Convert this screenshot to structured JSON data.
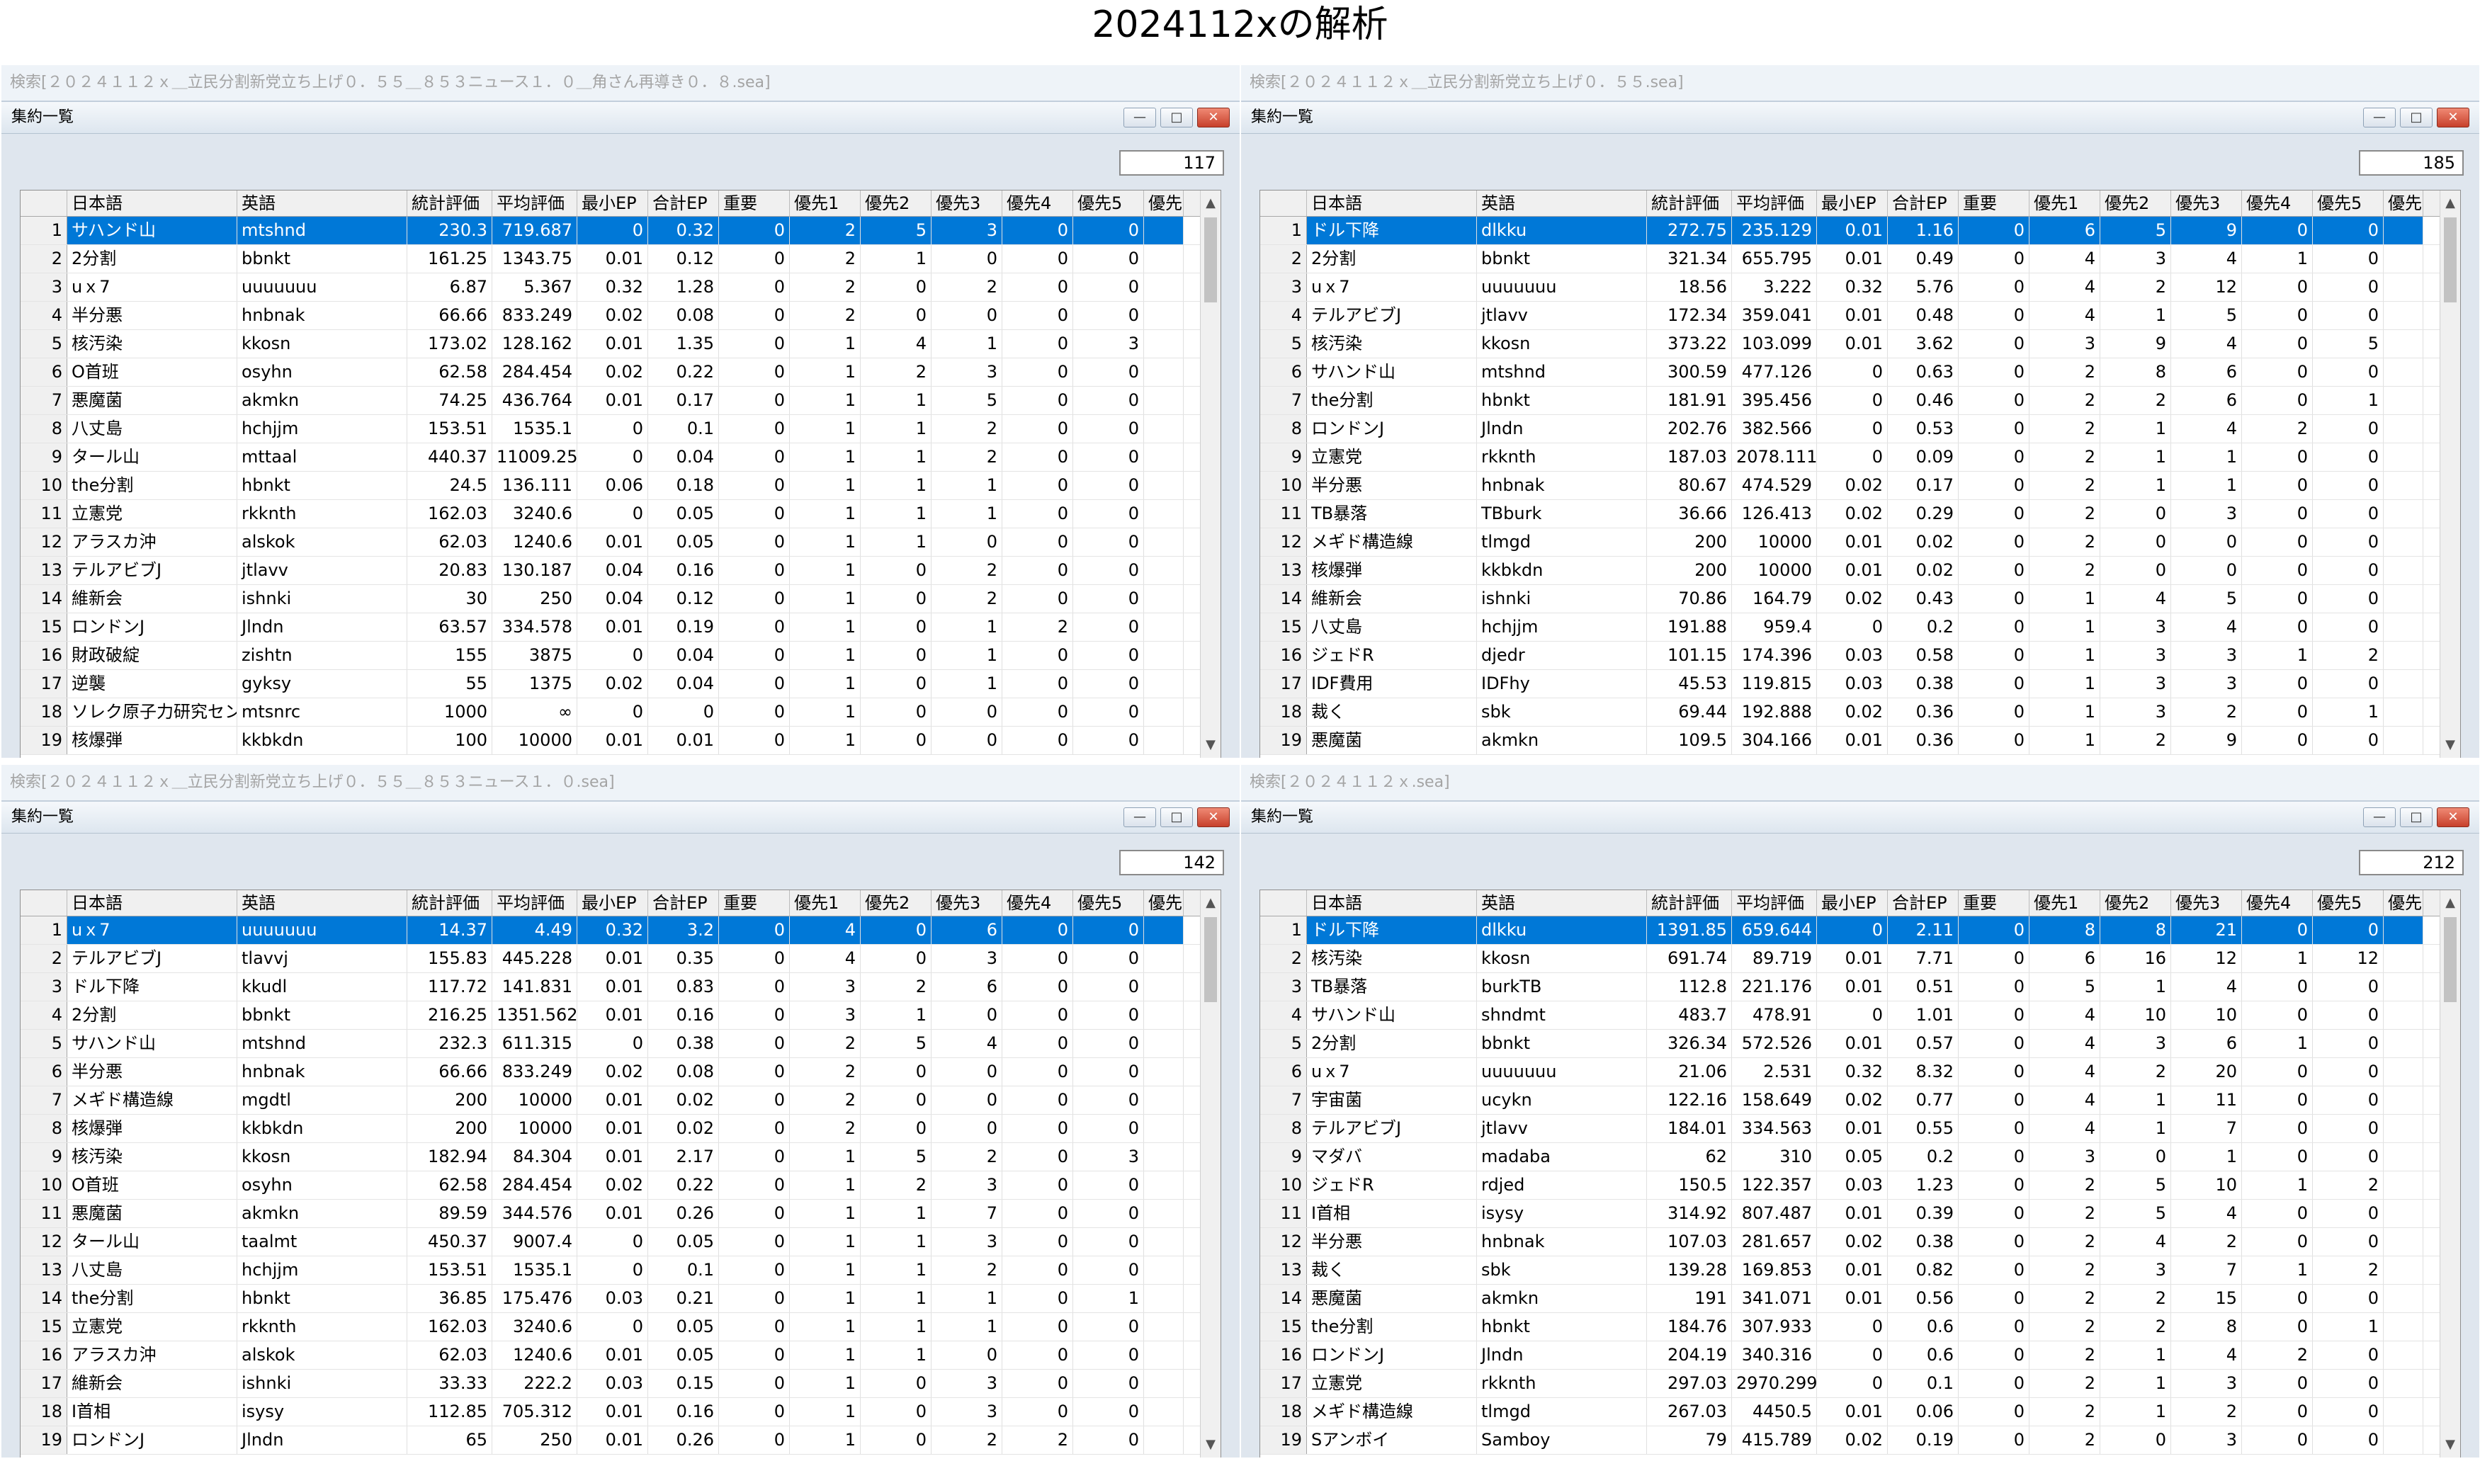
{
  "page_title": "2024112xの解析",
  "columns": [
    "日本語",
    "英語",
    "統計評価",
    "平均評価",
    "最小EP",
    "合計EP",
    "重要",
    "優先1",
    "優先2",
    "優先3",
    "優先4",
    "優先5",
    "優先"
  ],
  "window_title": "集約一覧",
  "panels": [
    {
      "search": "検索[２０２４１１２ｘ＿立民分割新党立ち上げ０．５５＿８５３ニュース１．０＿角さん再導き０．８.sea]",
      "count": "117",
      "selected_row": 0,
      "rows": [
        [
          "1",
          "サハンド山",
          "mtshnd",
          "230.3",
          "719.687",
          "0",
          "0.32",
          "0",
          "2",
          "5",
          "3",
          "0",
          "0"
        ],
        [
          "2",
          "2分割",
          "bbnkt",
          "161.25",
          "1343.75",
          "0.01",
          "0.12",
          "0",
          "2",
          "1",
          "0",
          "0",
          "0"
        ],
        [
          "3",
          "uｘ7",
          "uuuuuuu",
          "6.87",
          "5.367",
          "0.32",
          "1.28",
          "0",
          "2",
          "0",
          "2",
          "0",
          "0"
        ],
        [
          "4",
          "半分悪",
          "hnbnak",
          "66.66",
          "833.249",
          "0.02",
          "0.08",
          "0",
          "2",
          "0",
          "0",
          "0",
          "0"
        ],
        [
          "5",
          "核汚染",
          "kkosn",
          "173.02",
          "128.162",
          "0.01",
          "1.35",
          "0",
          "1",
          "4",
          "1",
          "0",
          "3"
        ],
        [
          "6",
          "O首班",
          "osyhn",
          "62.58",
          "284.454",
          "0.02",
          "0.22",
          "0",
          "1",
          "2",
          "3",
          "0",
          "0"
        ],
        [
          "7",
          "悪魔菌",
          "akmkn",
          "74.25",
          "436.764",
          "0.01",
          "0.17",
          "0",
          "1",
          "1",
          "5",
          "0",
          "0"
        ],
        [
          "8",
          "八丈島",
          "hchjjm",
          "153.51",
          "1535.1",
          "0",
          "0.1",
          "0",
          "1",
          "1",
          "2",
          "0",
          "0"
        ],
        [
          "9",
          "タール山",
          "mttaal",
          "440.37",
          "11009.25",
          "0",
          "0.04",
          "0",
          "1",
          "1",
          "2",
          "0",
          "0"
        ],
        [
          "10",
          "the分割",
          "hbnkt",
          "24.5",
          "136.111",
          "0.06",
          "0.18",
          "0",
          "1",
          "1",
          "1",
          "0",
          "0"
        ],
        [
          "11",
          "立憲党",
          "rkknth",
          "162.03",
          "3240.6",
          "0",
          "0.05",
          "0",
          "1",
          "1",
          "1",
          "0",
          "0"
        ],
        [
          "12",
          "アラスカ沖",
          "alskok",
          "62.03",
          "1240.6",
          "0.01",
          "0.05",
          "0",
          "1",
          "1",
          "0",
          "0",
          "0"
        ],
        [
          "13",
          "テルアビブJ",
          "jtlavv",
          "20.83",
          "130.187",
          "0.04",
          "0.16",
          "0",
          "1",
          "0",
          "2",
          "0",
          "0"
        ],
        [
          "14",
          "維新会",
          "ishnki",
          "30",
          "250",
          "0.04",
          "0.12",
          "0",
          "1",
          "0",
          "2",
          "0",
          "0"
        ],
        [
          "15",
          "ロンドンJ",
          "Jlndn",
          "63.57",
          "334.578",
          "0.01",
          "0.19",
          "0",
          "1",
          "0",
          "1",
          "2",
          "0"
        ],
        [
          "16",
          "財政破綻",
          "zishtn",
          "155",
          "3875",
          "0",
          "0.04",
          "0",
          "1",
          "0",
          "1",
          "0",
          "0"
        ],
        [
          "17",
          "逆襲",
          "gyksy",
          "55",
          "1375",
          "0.02",
          "0.04",
          "0",
          "1",
          "0",
          "1",
          "0",
          "0"
        ],
        [
          "18",
          "ソレク原子力研究セン",
          "mtsnrc",
          "1000",
          "∞",
          "0",
          "0",
          "0",
          "1",
          "0",
          "0",
          "0",
          "0"
        ],
        [
          "19",
          "核爆弾",
          "kkbkdn",
          "100",
          "10000",
          "0.01",
          "0.01",
          "0",
          "1",
          "0",
          "0",
          "0",
          "0"
        ]
      ]
    },
    {
      "search": "検索[２０２４１１２ｘ＿立民分割新党立ち上げ０．５５.sea]",
      "count": "185",
      "selected_row": 0,
      "rows": [
        [
          "1",
          "ドル下降",
          "dlkku",
          "272.75",
          "235.129",
          "0.01",
          "1.16",
          "0",
          "6",
          "5",
          "9",
          "0",
          "0"
        ],
        [
          "2",
          "2分割",
          "bbnkt",
          "321.34",
          "655.795",
          "0.01",
          "0.49",
          "0",
          "4",
          "3",
          "4",
          "1",
          "0"
        ],
        [
          "3",
          "uｘ7",
          "uuuuuuu",
          "18.56",
          "3.222",
          "0.32",
          "5.76",
          "0",
          "4",
          "2",
          "12",
          "0",
          "0"
        ],
        [
          "4",
          "テルアビブJ",
          "jtlavv",
          "172.34",
          "359.041",
          "0.01",
          "0.48",
          "0",
          "4",
          "1",
          "5",
          "0",
          "0"
        ],
        [
          "5",
          "核汚染",
          "kkosn",
          "373.22",
          "103.099",
          "0.01",
          "3.62",
          "0",
          "3",
          "9",
          "4",
          "0",
          "5"
        ],
        [
          "6",
          "サハンド山",
          "mtshnd",
          "300.59",
          "477.126",
          "0",
          "0.63",
          "0",
          "2",
          "8",
          "6",
          "0",
          "0"
        ],
        [
          "7",
          "the分割",
          "hbnkt",
          "181.91",
          "395.456",
          "0",
          "0.46",
          "0",
          "2",
          "2",
          "6",
          "0",
          "1"
        ],
        [
          "8",
          "ロンドンJ",
          "Jlndn",
          "202.76",
          "382.566",
          "0",
          "0.53",
          "0",
          "2",
          "1",
          "4",
          "2",
          "0"
        ],
        [
          "9",
          "立憲党",
          "rkknth",
          "187.03",
          "2078.111",
          "0",
          "0.09",
          "0",
          "2",
          "1",
          "1",
          "0",
          "0"
        ],
        [
          "10",
          "半分悪",
          "hnbnak",
          "80.67",
          "474.529",
          "0.02",
          "0.17",
          "0",
          "2",
          "1",
          "1",
          "0",
          "0"
        ],
        [
          "11",
          "TB暴落",
          "TBburk",
          "36.66",
          "126.413",
          "0.02",
          "0.29",
          "0",
          "2",
          "0",
          "3",
          "0",
          "0"
        ],
        [
          "12",
          "メギド構造線",
          "tlmgd",
          "200",
          "10000",
          "0.01",
          "0.02",
          "0",
          "2",
          "0",
          "0",
          "0",
          "0"
        ],
        [
          "13",
          "核爆弾",
          "kkbkdn",
          "200",
          "10000",
          "0.01",
          "0.02",
          "0",
          "2",
          "0",
          "0",
          "0",
          "0"
        ],
        [
          "14",
          "維新会",
          "ishnki",
          "70.86",
          "164.79",
          "0.02",
          "0.43",
          "0",
          "1",
          "4",
          "5",
          "0",
          "0"
        ],
        [
          "15",
          "八丈島",
          "hchjjm",
          "191.88",
          "959.4",
          "0",
          "0.2",
          "0",
          "1",
          "3",
          "4",
          "0",
          "0"
        ],
        [
          "16",
          "ジェドR",
          "djedr",
          "101.15",
          "174.396",
          "0.03",
          "0.58",
          "0",
          "1",
          "3",
          "3",
          "1",
          "2"
        ],
        [
          "17",
          "IDF費用",
          "IDFhy",
          "45.53",
          "119.815",
          "0.03",
          "0.38",
          "0",
          "1",
          "3",
          "3",
          "0",
          "0"
        ],
        [
          "18",
          "裁く",
          "sbk",
          "69.44",
          "192.888",
          "0.02",
          "0.36",
          "0",
          "1",
          "3",
          "2",
          "0",
          "1"
        ],
        [
          "19",
          "悪魔菌",
          "akmkn",
          "109.5",
          "304.166",
          "0.01",
          "0.36",
          "0",
          "1",
          "2",
          "9",
          "0",
          "0"
        ]
      ]
    },
    {
      "search": "検索[２０２４１１２ｘ＿立民分割新党立ち上げ０．５５＿８５３ニュース１．０.sea]",
      "count": "142",
      "selected_row": 0,
      "rows": [
        [
          "1",
          "uｘ7",
          "uuuuuuu",
          "14.37",
          "4.49",
          "0.32",
          "3.2",
          "0",
          "4",
          "0",
          "6",
          "0",
          "0"
        ],
        [
          "2",
          "テルアビブJ",
          "tlavvj",
          "155.83",
          "445.228",
          "0.01",
          "0.35",
          "0",
          "4",
          "0",
          "3",
          "0",
          "0"
        ],
        [
          "3",
          "ドル下降",
          "kkudl",
          "117.72",
          "141.831",
          "0.01",
          "0.83",
          "0",
          "3",
          "2",
          "6",
          "0",
          "0"
        ],
        [
          "4",
          "2分割",
          "bbnkt",
          "216.25",
          "1351.562",
          "0.01",
          "0.16",
          "0",
          "3",
          "1",
          "0",
          "0",
          "0"
        ],
        [
          "5",
          "サハンド山",
          "mtshnd",
          "232.3",
          "611.315",
          "0",
          "0.38",
          "0",
          "2",
          "5",
          "4",
          "0",
          "0"
        ],
        [
          "6",
          "半分悪",
          "hnbnak",
          "66.66",
          "833.249",
          "0.02",
          "0.08",
          "0",
          "2",
          "0",
          "0",
          "0",
          "0"
        ],
        [
          "7",
          "メギド構造線",
          "mgdtl",
          "200",
          "10000",
          "0.01",
          "0.02",
          "0",
          "2",
          "0",
          "0",
          "0",
          "0"
        ],
        [
          "8",
          "核爆弾",
          "kkbkdn",
          "200",
          "10000",
          "0.01",
          "0.02",
          "0",
          "2",
          "0",
          "0",
          "0",
          "0"
        ],
        [
          "9",
          "核汚染",
          "kkosn",
          "182.94",
          "84.304",
          "0.01",
          "2.17",
          "0",
          "1",
          "5",
          "2",
          "0",
          "3"
        ],
        [
          "10",
          "O首班",
          "osyhn",
          "62.58",
          "284.454",
          "0.02",
          "0.22",
          "0",
          "1",
          "2",
          "3",
          "0",
          "0"
        ],
        [
          "11",
          "悪魔菌",
          "akmkn",
          "89.59",
          "344.576",
          "0.01",
          "0.26",
          "0",
          "1",
          "1",
          "7",
          "0",
          "0"
        ],
        [
          "12",
          "タール山",
          "taalmt",
          "450.37",
          "9007.4",
          "0",
          "0.05",
          "0",
          "1",
          "1",
          "3",
          "0",
          "0"
        ],
        [
          "13",
          "八丈島",
          "hchjjm",
          "153.51",
          "1535.1",
          "0",
          "0.1",
          "0",
          "1",
          "1",
          "2",
          "0",
          "0"
        ],
        [
          "14",
          "the分割",
          "hbnkt",
          "36.85",
          "175.476",
          "0.03",
          "0.21",
          "0",
          "1",
          "1",
          "1",
          "0",
          "1"
        ],
        [
          "15",
          "立憲党",
          "rkknth",
          "162.03",
          "3240.6",
          "0",
          "0.05",
          "0",
          "1",
          "1",
          "1",
          "0",
          "0"
        ],
        [
          "16",
          "アラスカ沖",
          "alskok",
          "62.03",
          "1240.6",
          "0.01",
          "0.05",
          "0",
          "1",
          "1",
          "0",
          "0",
          "0"
        ],
        [
          "17",
          "維新会",
          "ishnki",
          "33.33",
          "222.2",
          "0.03",
          "0.15",
          "0",
          "1",
          "0",
          "3",
          "0",
          "0"
        ],
        [
          "18",
          "I首相",
          "isysy",
          "112.85",
          "705.312",
          "0.01",
          "0.16",
          "0",
          "1",
          "0",
          "3",
          "0",
          "0"
        ],
        [
          "19",
          "ロンドンJ",
          "Jlndn",
          "65",
          "250",
          "0.01",
          "0.26",
          "0",
          "1",
          "0",
          "2",
          "2",
          "0"
        ]
      ]
    },
    {
      "search": "検索[２０２４１１２ｘ.sea]",
      "count": "212",
      "selected_row": 0,
      "rows": [
        [
          "1",
          "ドル下降",
          "dlkku",
          "1391.85",
          "659.644",
          "0",
          "2.11",
          "0",
          "8",
          "8",
          "21",
          "0",
          "0"
        ],
        [
          "2",
          "核汚染",
          "kkosn",
          "691.74",
          "89.719",
          "0.01",
          "7.71",
          "0",
          "6",
          "16",
          "12",
          "1",
          "12"
        ],
        [
          "3",
          "TB暴落",
          "burkTB",
          "112.8",
          "221.176",
          "0.01",
          "0.51",
          "0",
          "5",
          "1",
          "4",
          "0",
          "0"
        ],
        [
          "4",
          "サハンド山",
          "shndmt",
          "483.7",
          "478.91",
          "0",
          "1.01",
          "0",
          "4",
          "10",
          "10",
          "0",
          "0"
        ],
        [
          "5",
          "2分割",
          "bbnkt",
          "326.34",
          "572.526",
          "0.01",
          "0.57",
          "0",
          "4",
          "3",
          "6",
          "1",
          "0"
        ],
        [
          "6",
          "uｘ7",
          "uuuuuuu",
          "21.06",
          "2.531",
          "0.32",
          "8.32",
          "0",
          "4",
          "2",
          "20",
          "0",
          "0"
        ],
        [
          "7",
          "宇宙菌",
          "ucykn",
          "122.16",
          "158.649",
          "0.02",
          "0.77",
          "0",
          "4",
          "1",
          "11",
          "0",
          "0"
        ],
        [
          "8",
          "テルアビブJ",
          "jtlavv",
          "184.01",
          "334.563",
          "0.01",
          "0.55",
          "0",
          "4",
          "1",
          "7",
          "0",
          "0"
        ],
        [
          "9",
          "マダバ",
          "madaba",
          "62",
          "310",
          "0.05",
          "0.2",
          "0",
          "3",
          "0",
          "1",
          "0",
          "0"
        ],
        [
          "10",
          "ジェドR",
          "rdjed",
          "150.5",
          "122.357",
          "0.03",
          "1.23",
          "0",
          "2",
          "5",
          "10",
          "1",
          "2"
        ],
        [
          "11",
          "I首相",
          "isysy",
          "314.92",
          "807.487",
          "0.01",
          "0.39",
          "0",
          "2",
          "5",
          "4",
          "0",
          "0"
        ],
        [
          "12",
          "半分悪",
          "hnbnak",
          "107.03",
          "281.657",
          "0.02",
          "0.38",
          "0",
          "2",
          "4",
          "2",
          "0",
          "0"
        ],
        [
          "13",
          "裁く",
          "sbk",
          "139.28",
          "169.853",
          "0.01",
          "0.82",
          "0",
          "2",
          "3",
          "7",
          "1",
          "2"
        ],
        [
          "14",
          "悪魔菌",
          "akmkn",
          "191",
          "341.071",
          "0.01",
          "0.56",
          "0",
          "2",
          "2",
          "15",
          "0",
          "0"
        ],
        [
          "15",
          "the分割",
          "hbnkt",
          "184.76",
          "307.933",
          "0",
          "0.6",
          "0",
          "2",
          "2",
          "8",
          "0",
          "1"
        ],
        [
          "16",
          "ロンドンJ",
          "Jlndn",
          "204.19",
          "340.316",
          "0",
          "0.6",
          "0",
          "2",
          "1",
          "4",
          "2",
          "0"
        ],
        [
          "17",
          "立憲党",
          "rkknth",
          "297.03",
          "2970.299",
          "0",
          "0.1",
          "0",
          "2",
          "1",
          "3",
          "0",
          "0"
        ],
        [
          "18",
          "メギド構造線",
          "tlmgd",
          "267.03",
          "4450.5",
          "0.01",
          "0.06",
          "0",
          "2",
          "1",
          "2",
          "0",
          "0"
        ],
        [
          "19",
          "Sアンボイ",
          "Samboy",
          "79",
          "415.789",
          "0.02",
          "0.19",
          "0",
          "2",
          "0",
          "3",
          "0",
          "0"
        ]
      ]
    }
  ]
}
